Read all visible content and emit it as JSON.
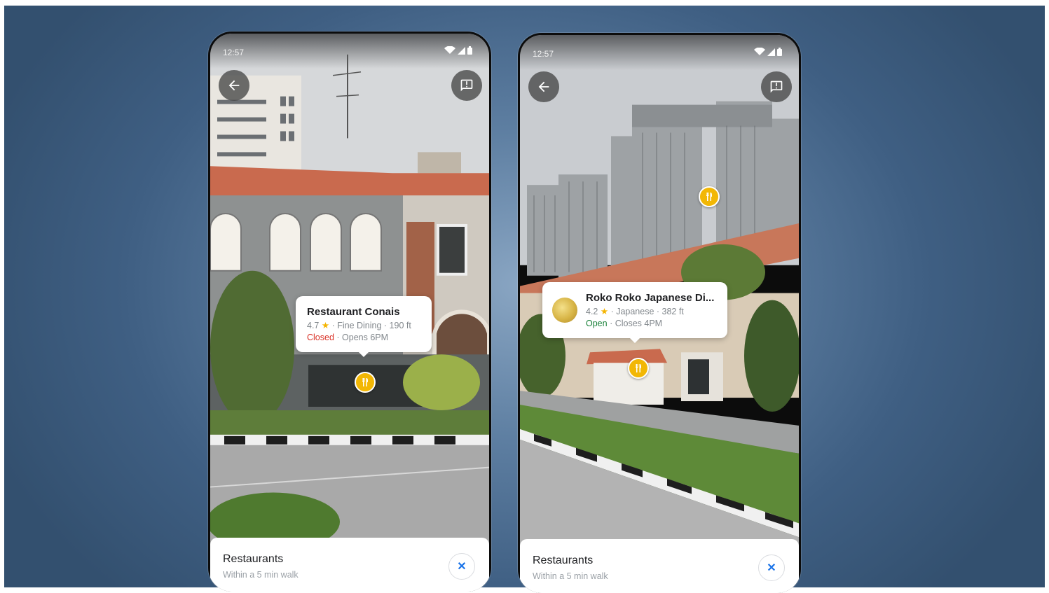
{
  "phones": [
    {
      "status_time": "12:57",
      "place": {
        "name": "Restaurant Conais",
        "rating": "4.7",
        "details": " · Fine Dining · 190 ft",
        "status": "Closed",
        "hours": " · Opens 6PM"
      },
      "sheet": {
        "title": "Restaurants",
        "subtitle": "Within a 5 min walk",
        "close_glyph": "✕"
      }
    },
    {
      "status_time": "12:57",
      "place": {
        "name": "Roko Roko Japanese Di...",
        "rating": "4.2",
        "details": " · Japanese · 382 ft",
        "status": "Open",
        "hours": " · Closes 4PM"
      },
      "sheet": {
        "title": "Restaurants",
        "subtitle": "Within a 5 min walk",
        "close_glyph": "✕"
      }
    }
  ],
  "icons": {
    "back": "arrow-left-icon",
    "feedback": "feedback-icon",
    "restaurant_pin": "fork-knife-icon",
    "star": "★",
    "wifi": "wifi-icon",
    "signal": "signal-icon",
    "battery": "battery-icon"
  },
  "colors": {
    "closed": "#d93025",
    "open": "#188038",
    "pin": "#f2b705",
    "close_x": "#1a73e8"
  }
}
